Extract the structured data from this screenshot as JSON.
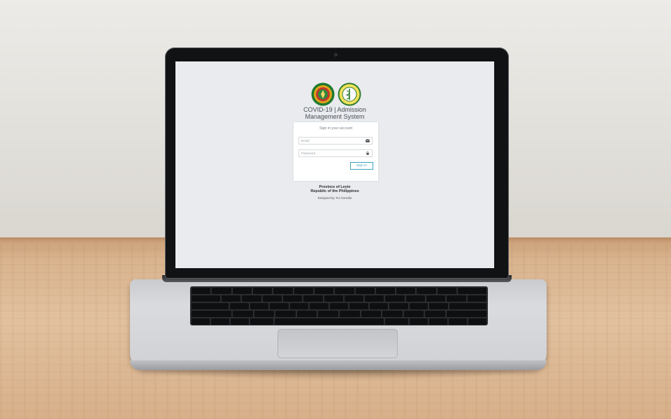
{
  "app": {
    "title_line1": "COVID-19 | Admission",
    "title_line2": "Management System"
  },
  "logos": [
    {
      "name": "province-seal-icon",
      "colors": [
        "#1f7a2e",
        "#e0a51a",
        "#c0392b"
      ]
    },
    {
      "name": "health-office-seal-icon",
      "colors": [
        "#f2e15a",
        "#2e7d32"
      ]
    }
  ],
  "login": {
    "message": "Sign in your account",
    "email": {
      "value": "",
      "placeholder": "Email",
      "icon": "envelope-icon"
    },
    "password": {
      "value": "",
      "placeholder": "Password",
      "icon": "lock-icon"
    },
    "submit_label": "Sign In"
  },
  "footer": {
    "province": "Province of Leyte",
    "republic": "Republic of the Philippines",
    "credit": "Designed by: RJ Gonzalo"
  },
  "colors": {
    "page_bg": "#e9ebee",
    "card_bg": "#ffffff",
    "accent": "#3aa2b8",
    "title_text": "#4a5159"
  }
}
